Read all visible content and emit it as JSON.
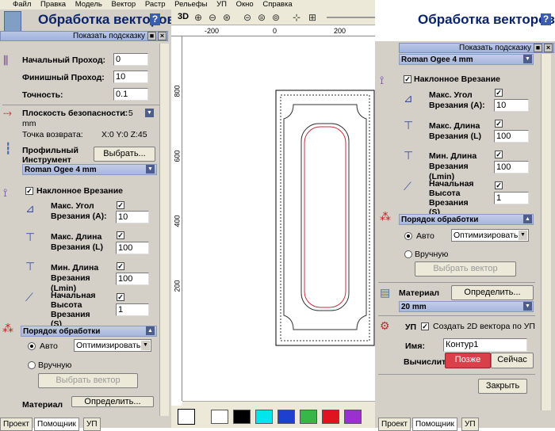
{
  "menu": [
    "Файл",
    "Правка",
    "Модель",
    "Вектор",
    "Растр",
    "Рельефы",
    "УП",
    "Окно",
    "Справка"
  ],
  "left": {
    "title": "Обработка векторов",
    "hint": "Показать подсказку",
    "start_pass_label": "Начальный Проход:",
    "start_pass": "0",
    "final_pass_label": "Финишный Проход:",
    "final_pass": "10",
    "accuracy_label": "Точность:",
    "accuracy": "0.1",
    "safe_plane_label": "Плоскость безопасности:",
    "safe_plane_value": ": 5",
    "safe_plane_unit": "mm",
    "return_label": "Точка возврата:",
    "return_value": "X:0 Y:0 Z:45",
    "tool_label": "Профильный Инструмент",
    "select_btn": "Выбрать...",
    "tool_name": "Roman Ogee 4 mm",
    "ramp_label": "Наклонное Врезание",
    "max_angle_label": "Макс. Угол Врезания (A):",
    "max_angle": "10",
    "max_len_label": "Макс. Длина Врезания (L)",
    "max_len": "100",
    "min_len_label": "Мин. Длина Врезания (Lmin)",
    "min_len": "100",
    "start_height_label": "Начальная Высота Врезания (S)",
    "start_height": "1",
    "order_label": "Порядок обработки",
    "auto_label": "Авто",
    "optimize": "Оптимизировать",
    "manual_label": "Вручную",
    "select_vector": "Выбрать вектор",
    "material_label": "Материал",
    "define_btn": "Определить...",
    "tabs": [
      "Проект",
      "Помощник",
      "УП"
    ]
  },
  "toolbar": {
    "mode3d": "3D"
  },
  "ruler": {
    "top": [
      "-200",
      "0",
      "200"
    ],
    "left": [
      "800",
      "600",
      "400",
      "200"
    ]
  },
  "right": {
    "title": "Обработка векторов",
    "hint": "Показать подсказку",
    "tool_name": "Roman Ogee 4 mm",
    "ramp_label": "Наклонное Врезание",
    "max_angle_label": "Макс. Угол Врезания (A):",
    "max_angle": "10",
    "max_len_label": "Макс. Длина Врезания (L)",
    "max_len": "100",
    "min_len_label": "Мин. Длина Врезания (Lmin)",
    "min_len": "100",
    "start_height_label": "Начальная Высота Врезания (S)",
    "start_height": "1",
    "order_label": "Порядок обработки",
    "auto_label": "Авто",
    "optimize": "Оптимизировать",
    "manual_label": "Вручную",
    "select_vector": "Выбрать вектор",
    "material_label": "Материал",
    "define_btn": "Определить...",
    "material_thickness": "20 mm",
    "tp_label": "УП",
    "create_2d": "Создать 2D вектора по УП",
    "name_label": "Имя:",
    "name_value": "Контур1",
    "calc_label": "Вычислить:",
    "later_btn": "Позже",
    "now_btn": "Сейчас",
    "close_btn": "Закрыть",
    "tabs": [
      "Проект",
      "Помощник",
      "УП"
    ]
  },
  "palette": [
    "#ffffff",
    "#000000",
    "#00e5ee",
    "#1e3fd0",
    "#37b64a",
    "#e0141e",
    "#9b30d0"
  ],
  "colors": {
    "title": "#0a246a",
    "later_bg": "#d9404a"
  }
}
